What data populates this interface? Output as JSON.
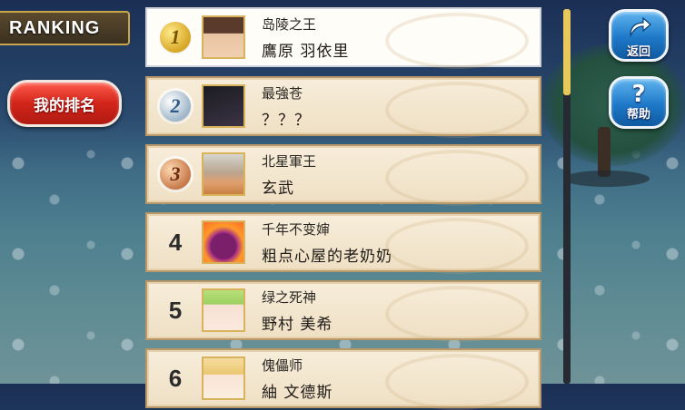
{
  "header": {
    "title": "RANKING"
  },
  "my_rank_button": {
    "label": "我的排名"
  },
  "right_buttons": {
    "back": {
      "icon": "return-arrow-icon",
      "label": "返回"
    },
    "help": {
      "icon": "question-mark-icon",
      "glyph": "?",
      "label": "帮助"
    }
  },
  "ranking_list": [
    {
      "rank": "1",
      "badge": "gold",
      "title": "岛陵之王",
      "name": "鷹原 羽依里",
      "highlighted": true
    },
    {
      "rank": "2",
      "badge": "silver",
      "title": "最強苍",
      "name": "？？？",
      "highlighted": false
    },
    {
      "rank": "3",
      "badge": "bronze",
      "title": "北星軍王",
      "name": "玄武",
      "highlighted": false
    },
    {
      "rank": "4",
      "badge": "none",
      "title": "千年不变婶",
      "name": "粗点心屋的老奶奶",
      "highlighted": false
    },
    {
      "rank": "5",
      "badge": "none",
      "title": "绿之死神",
      "name": "野村 美希",
      "highlighted": false
    },
    {
      "rank": "6",
      "badge": "none",
      "title": "傀儡师",
      "name": "紬 文德斯",
      "highlighted": false
    }
  ],
  "scrollbar": {
    "position_fraction": 0.0
  }
}
